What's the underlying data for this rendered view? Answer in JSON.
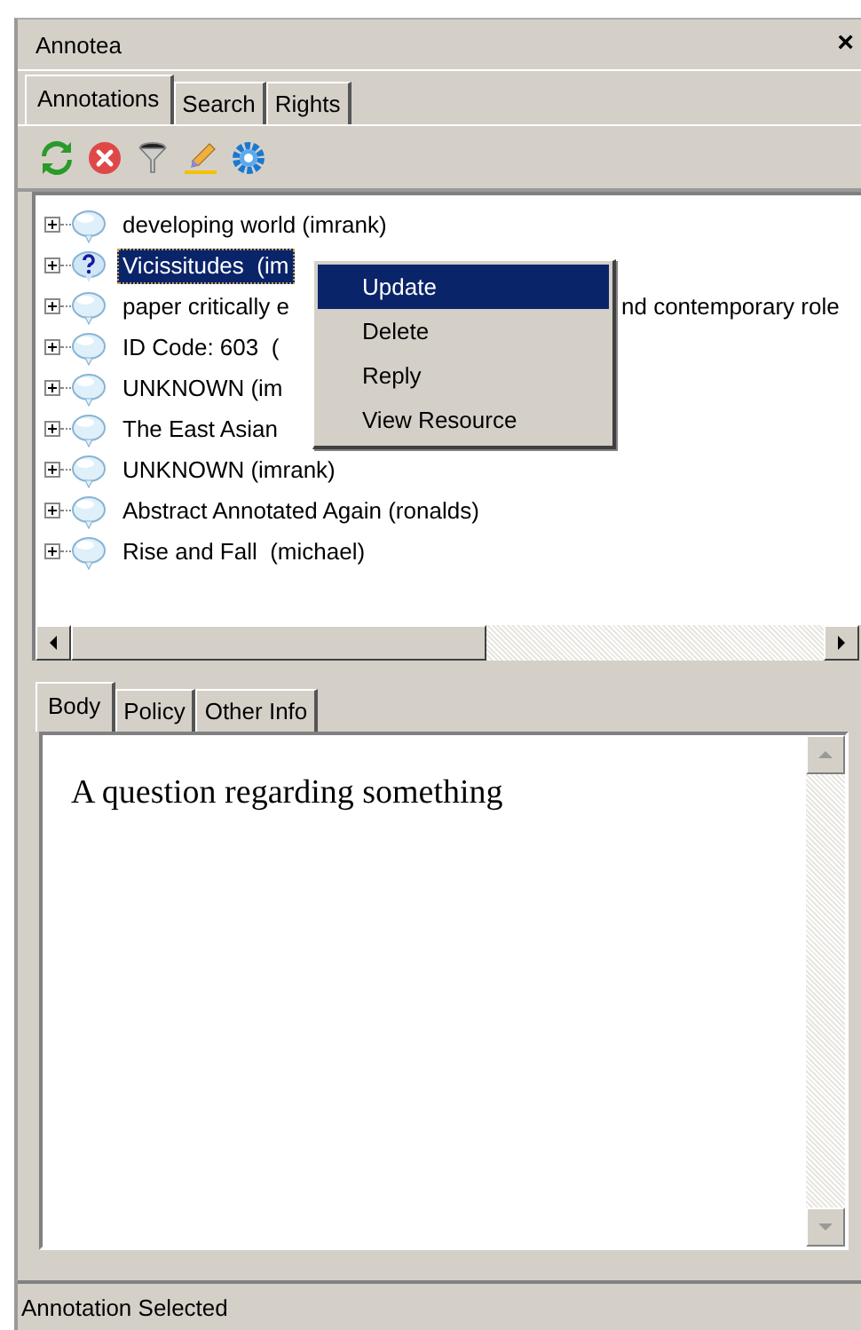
{
  "window": {
    "title": "Annotea",
    "close": "×"
  },
  "tabs": [
    {
      "label": "Annotations",
      "selected": true
    },
    {
      "label": "Search",
      "selected": false
    },
    {
      "label": "Rights",
      "selected": false
    }
  ],
  "tree": {
    "items": [
      {
        "text": "developing world (imrank)",
        "kind": "comment",
        "selected": false,
        "expanded": false
      },
      {
        "text": "Vicissitudes  (im",
        "kind": "question",
        "selected": true,
        "expanded": false
      },
      {
        "text": "paper critically e",
        "tail": "nd contemporary role",
        "kind": "comment",
        "selected": false,
        "expanded": false
      },
      {
        "text": "ID Code: 603  (",
        "kind": "comment",
        "selected": false,
        "expanded": false
      },
      {
        "text": "UNKNOWN (im",
        "kind": "comment",
        "selected": false,
        "expanded": false
      },
      {
        "text": "The East Asian",
        "kind": "comment",
        "selected": false,
        "expanded": false
      },
      {
        "text": "UNKNOWN (imrank)",
        "kind": "comment",
        "selected": false,
        "expanded": false
      },
      {
        "text": "Abstract Annotated Again (ronalds)",
        "kind": "comment",
        "selected": false,
        "expanded": false
      },
      {
        "text": "Rise and Fall  (michael)",
        "kind": "comment",
        "selected": false,
        "expanded": false
      }
    ]
  },
  "context_menu": {
    "items": [
      {
        "label": "Update",
        "selected": true
      },
      {
        "label": "Delete",
        "selected": false
      },
      {
        "label": "Reply",
        "selected": false
      },
      {
        "label": "View Resource",
        "selected": false
      }
    ]
  },
  "detail_tabs": [
    {
      "label": "Body",
      "selected": true
    },
    {
      "label": "Policy",
      "selected": false
    },
    {
      "label": "Other Info",
      "selected": false
    }
  ],
  "body_text": "A question regarding something",
  "status_bar": "Annotation Selected"
}
